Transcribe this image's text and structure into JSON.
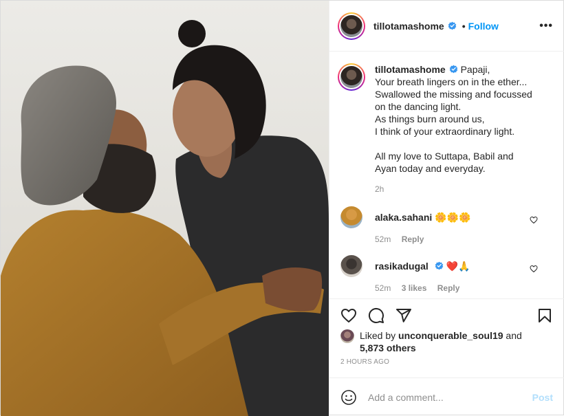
{
  "header": {
    "username": "tillotamashome",
    "dot": "•",
    "follow_label": "Follow",
    "more_label": "•••"
  },
  "caption": {
    "username": "tillotamashome",
    "lines": [
      "Papaji,",
      "Your breath lingers on in the ether...",
      "Swallowed the missing and focussed",
      "on the dancing light.",
      "As things burn around us,",
      "I think of your extraordinary light.",
      "",
      "All my love to Suttapa, Babil and",
      "Ayan today and everyday."
    ],
    "time": "2h"
  },
  "comments": [
    {
      "username": "alaka.sahani",
      "text": "🌼🌼🌼",
      "time": "52m",
      "reply_label": "Reply",
      "likes": ""
    },
    {
      "username": "rasikadugal",
      "text": "❤️🙏",
      "time": "52m",
      "likes": "3 likes",
      "reply_label": "Reply"
    }
  ],
  "actions": {
    "icons": [
      "heart-icon",
      "comment-icon",
      "share-icon",
      "bookmark-icon"
    ]
  },
  "likes": {
    "prefix": "Liked by ",
    "user": "unconquerable_soul19",
    "and": " and",
    "others": "5,873 others"
  },
  "posted_time": "2 HOURS AGO",
  "add_comment": {
    "placeholder": "Add a comment...",
    "post_label": "Post"
  },
  "colors": {
    "accent": "#0095f6",
    "post_disabled": "#b2dffc",
    "muted": "#8e8e8e"
  }
}
